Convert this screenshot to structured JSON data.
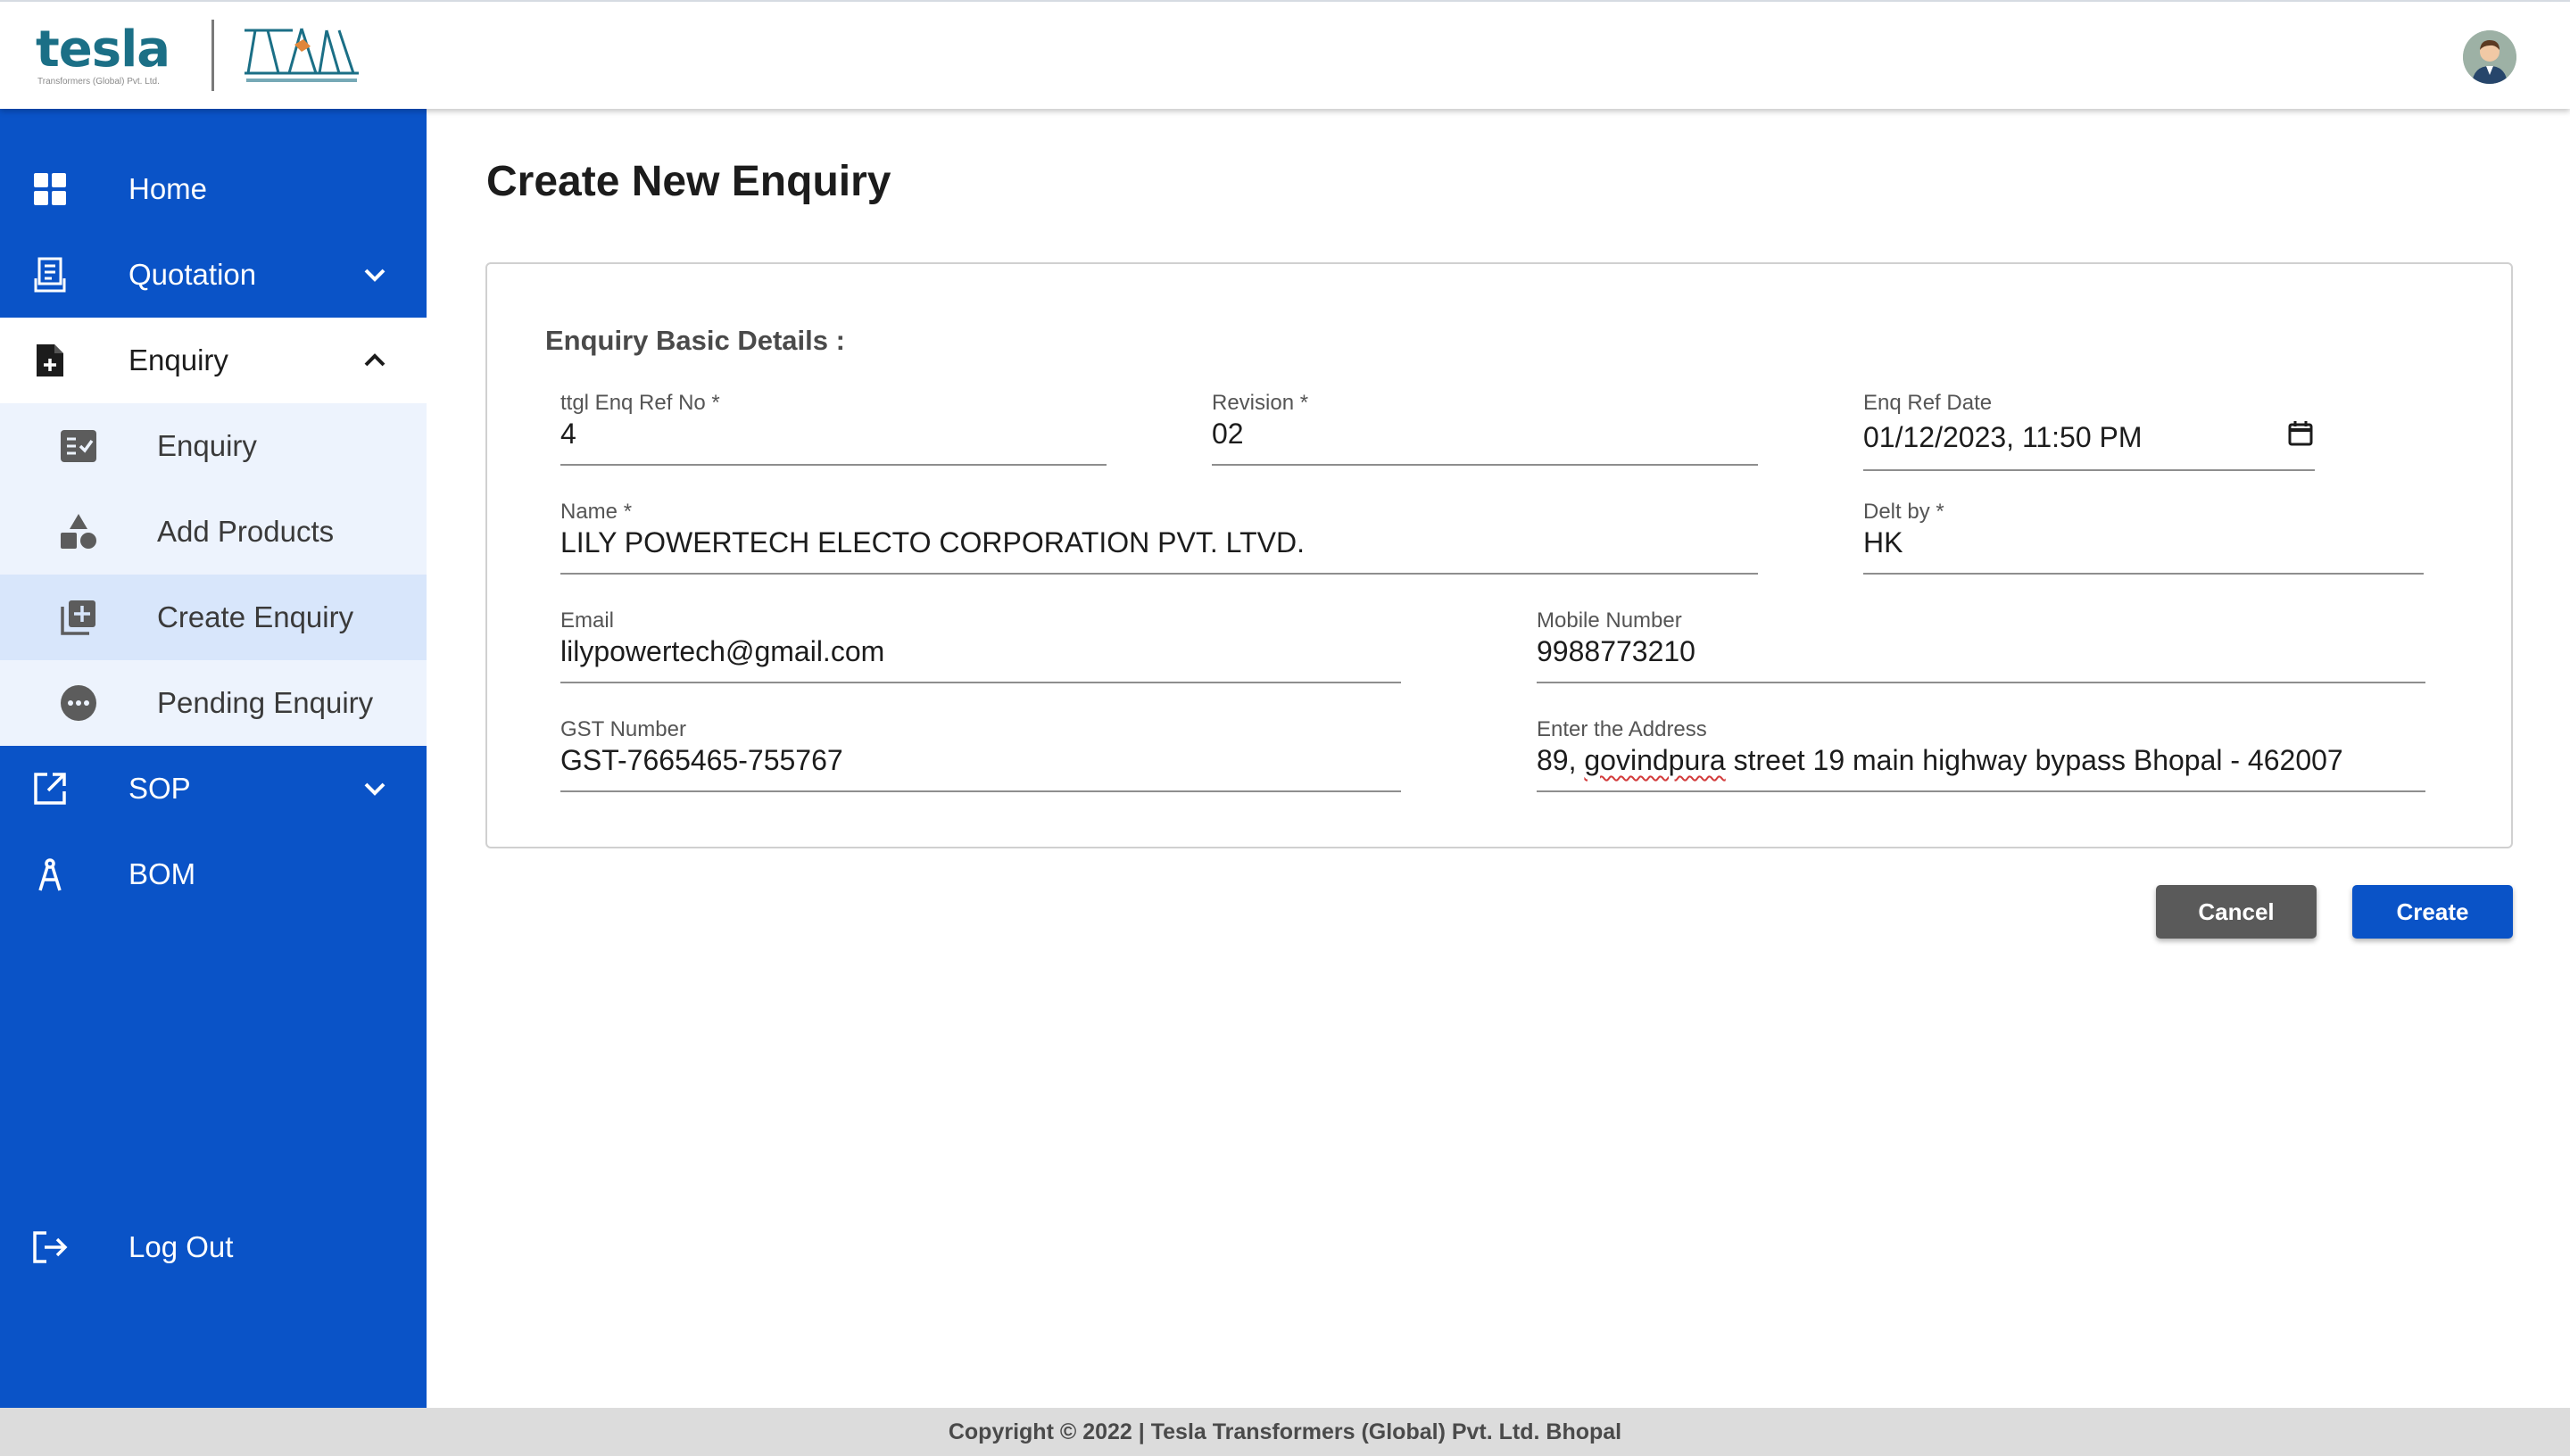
{
  "header": {
    "logo_word": "tesla",
    "logo_sub": "Transformers (Global) Pvt. Ltd.",
    "avatar_icon": "user-avatar-icon"
  },
  "sidebar": {
    "items": [
      {
        "label": "Home",
        "icon": "grid-icon"
      },
      {
        "label": "Quotation",
        "icon": "receipt-icon"
      },
      {
        "label": "Enquiry",
        "icon": "document-add-icon"
      },
      {
        "label": "SOP",
        "icon": "external-link-icon"
      },
      {
        "label": "BOM",
        "icon": "compass-icon"
      },
      {
        "label": "Log Out",
        "icon": "logout-icon"
      }
    ],
    "sub_items": [
      {
        "label": "Enquiry",
        "icon": "checklist-icon"
      },
      {
        "label": "Add Products",
        "icon": "shapes-icon"
      },
      {
        "label": "Create Enquiry",
        "icon": "library-add-icon"
      },
      {
        "label": "Pending Enquiry",
        "icon": "pending-icon"
      }
    ]
  },
  "main": {
    "title": "Create New Enquiry",
    "section_title": "Enquiry Basic Details :",
    "fields": {
      "ref_no": {
        "label": "ttgl Enq Ref No *",
        "value": "4"
      },
      "revision": {
        "label": "Revision *",
        "value": "02"
      },
      "ref_date": {
        "label": "Enq Ref Date",
        "value": "01/12/2023, 11:50 PM"
      },
      "name": {
        "label": "Name *",
        "value": "LILY POWERTECH ELECTO CORPORATION PVT. LTVD."
      },
      "delt_by": {
        "label": "Delt by *",
        "value": "HK"
      },
      "email": {
        "label": "Email",
        "value": "lilypowertech@gmail.com"
      },
      "mobile": {
        "label": "Mobile Number",
        "value": "9988773210"
      },
      "gst": {
        "label": "GST Number",
        "value": "GST-7665465-755767"
      },
      "address": {
        "label": "Enter the Address",
        "value_prefix": "89, ",
        "value_spell": "govindpura",
        "value_rest": " street 19 main highway bypass Bhopal - 462007"
      }
    },
    "buttons": {
      "cancel": "Cancel",
      "create": "Create"
    }
  },
  "footer": {
    "text": "Copyright © 2022 | Tesla Transformers (Global) Pvt. Ltd. Bhopal"
  },
  "colors": {
    "sidebar": "#0a53c7",
    "primary_button": "#0a53c7",
    "cancel_button": "#5a5a5a",
    "logo_teal": "#1b6f86"
  }
}
